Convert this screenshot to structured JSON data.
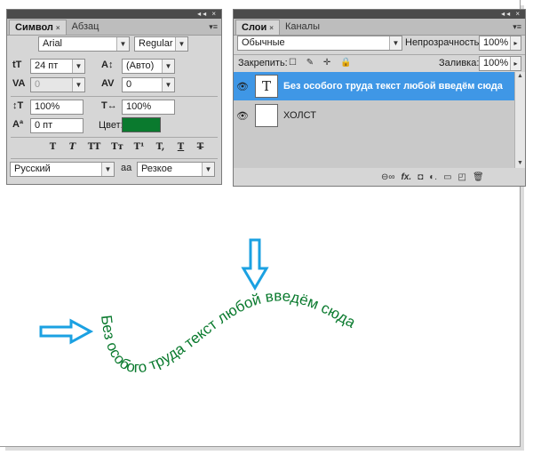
{
  "character_panel": {
    "tabs": [
      {
        "label": "Символ",
        "close": "×"
      },
      {
        "label": "Абзац"
      }
    ],
    "window_controls": "◂◂ ×",
    "menu_icon": "▾≡",
    "font_family": "Arial",
    "font_style": "Regular",
    "font_size": "24 пт",
    "leading": "(Авто)",
    "kerning": "0",
    "tracking": "0",
    "vertical_scale": "100%",
    "horizontal_scale": "100%",
    "baseline_shift": "0 пт",
    "color_label": "Цвет:",
    "color": "#0a7a2e",
    "style_buttons": [
      "T",
      "T",
      "TT",
      "Tт",
      "T¹",
      "T,",
      "T",
      "T"
    ],
    "language": "Русский",
    "antialias_icon": "aa",
    "antialias": "Резкое",
    "icons": {
      "size_icon": "tT",
      "leading_icon": "A↕",
      "kerning_icon": "VA",
      "tracking_icon": "AV",
      "vscale_icon": "↕T",
      "hscale_icon": "T↔",
      "baseline_icon": "Aª"
    }
  },
  "layers_panel": {
    "tabs": [
      {
        "label": "Слои",
        "close": "×"
      },
      {
        "label": "Каналы"
      }
    ],
    "window_controls": "◂◂ ×",
    "menu_icon": "▾≡",
    "blend_mode": "Обычные",
    "opacity_label": "Непрозрачность:",
    "opacity": "100%",
    "lock_label": "Закрепить:",
    "lock_icons": "☐ ✎ ✛ 🔒",
    "fill_label": "Заливка:",
    "fill": "100%",
    "layers": [
      {
        "thumb": "T",
        "name": "Без особого труда текст любой введём сюда",
        "selected": true,
        "eye": "👁"
      },
      {
        "thumb": "",
        "name": "ХОЛСТ",
        "selected": false,
        "eye": "👁"
      }
    ],
    "bottom_icons": [
      "⊖∞",
      "fx.",
      "◘",
      "◐.",
      "▭",
      "◰",
      "🗑"
    ]
  },
  "canvas": {
    "path_text": "Без особого труда текст любой введём сюда",
    "text_color": "#0a7a2e",
    "arrow_color": "#1ba1e2"
  }
}
